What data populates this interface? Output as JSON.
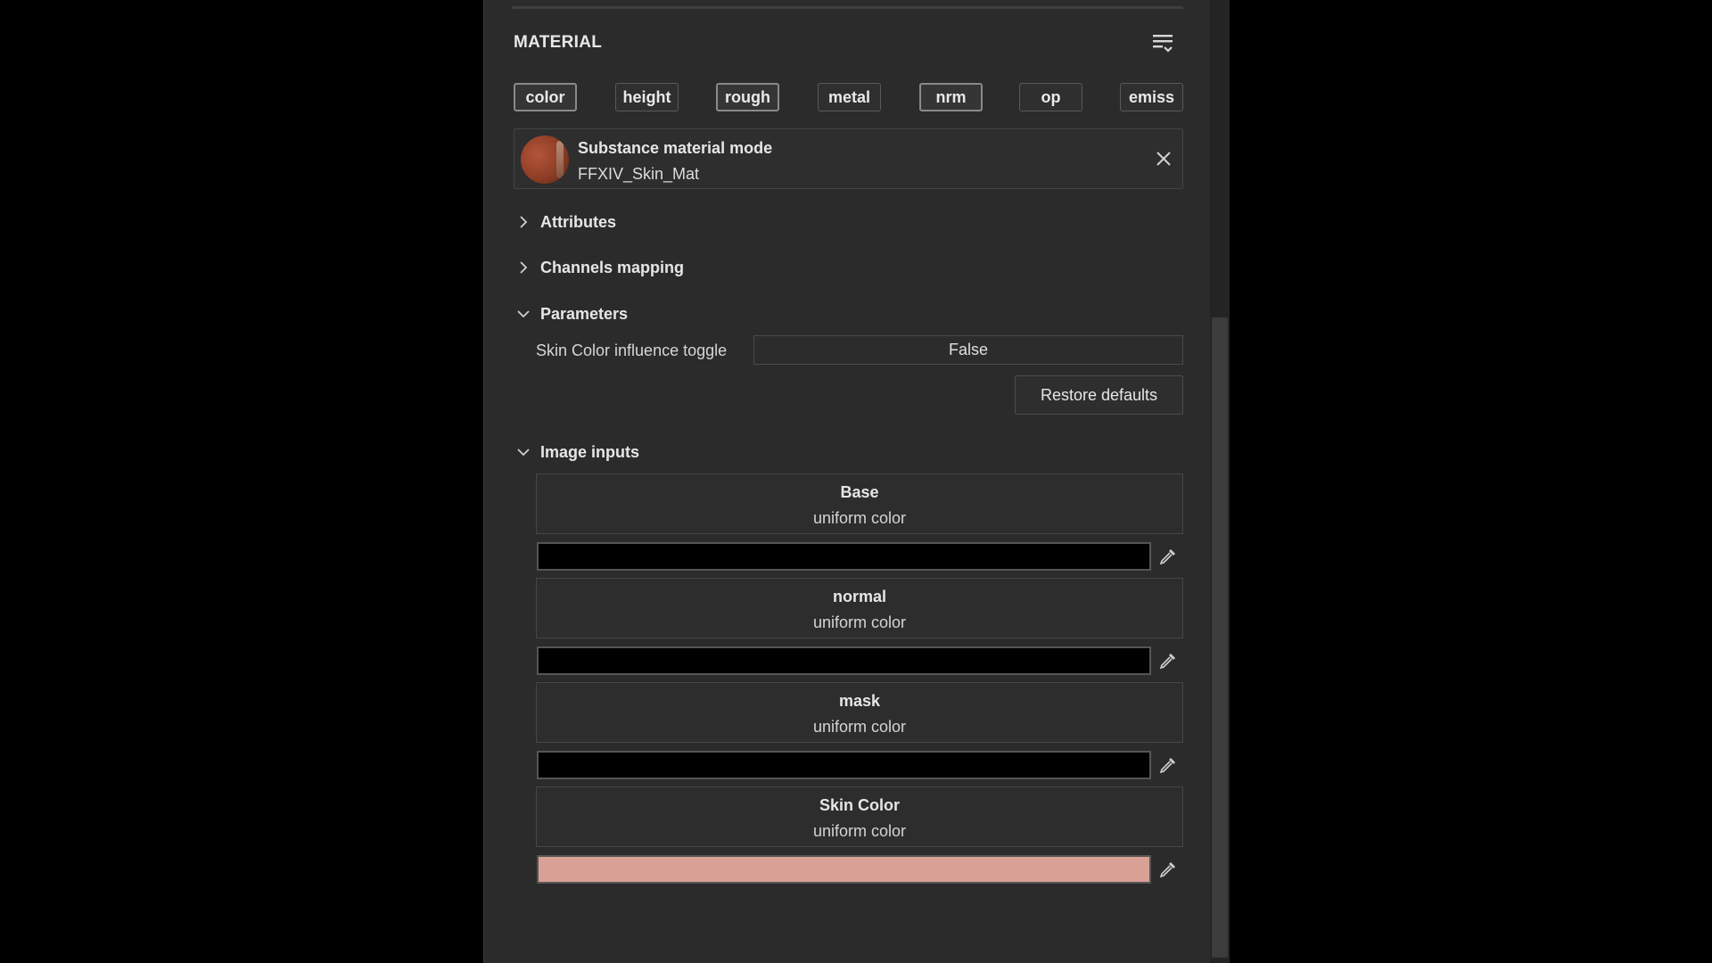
{
  "panel": {
    "title": "MATERIAL",
    "menu_icon": "list-filter-icon"
  },
  "channels": [
    {
      "label": "color",
      "active": true
    },
    {
      "label": "height",
      "active": false
    },
    {
      "label": "rough",
      "active": true
    },
    {
      "label": "metal",
      "active": false
    },
    {
      "label": "nrm",
      "active": true
    },
    {
      "label": "op",
      "active": false
    },
    {
      "label": "emiss",
      "active": false
    }
  ],
  "material": {
    "mode": "Substance material mode",
    "name": "FFXIV_Skin_Mat",
    "close_icon": "close-icon"
  },
  "sections": {
    "attributes": {
      "label": "Attributes",
      "expanded": false
    },
    "channels_mapping": {
      "label": "Channels mapping",
      "expanded": false
    },
    "parameters": {
      "label": "Parameters",
      "expanded": true
    },
    "image_inputs": {
      "label": "Image inputs",
      "expanded": true
    }
  },
  "parameters": {
    "skin_toggle_label": "Skin Color influence toggle",
    "skin_toggle_value": "False",
    "restore_label": "Restore defaults"
  },
  "image_inputs": [
    {
      "name": "Base",
      "type": "uniform color",
      "color": "#000000"
    },
    {
      "name": "normal",
      "type": "uniform color",
      "color": "#000000"
    },
    {
      "name": "mask",
      "type": "uniform color",
      "color": "#000000"
    },
    {
      "name": "Skin Color",
      "type": "uniform color",
      "color": "#d9a096"
    }
  ],
  "colors": {
    "panel_bg": "#2b2b2b",
    "skin_color": "#d9a096"
  }
}
